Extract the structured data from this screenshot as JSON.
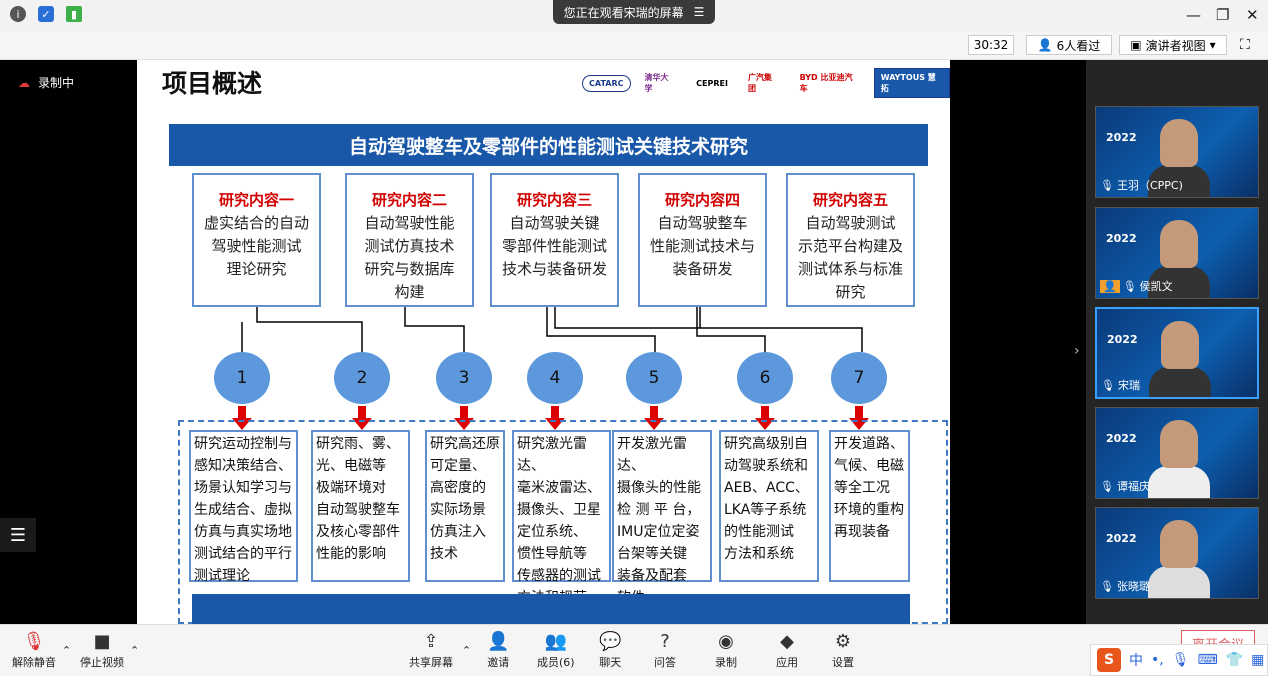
{
  "titlebar": {
    "viewing": "您正在观看宋瑞的屏幕",
    "viewing_icon": "list-icon"
  },
  "toolbar": {
    "timer": "30:32",
    "viewers": "6人看过",
    "speaker_view": "演讲者视图"
  },
  "stage": {
    "recording": "录制中"
  },
  "slide": {
    "title": "项目概述",
    "logos": [
      "CATARC",
      "清华大学",
      "CEPREI",
      "广汽集团",
      "BYD 比亚迪汽车",
      "WAYTOUS 慧拓"
    ],
    "banner": "自动驾驶整车及零部件的性能测试关键技术研究",
    "cards": [
      {
        "head": "研究内容一",
        "lines": [
          "虚实结合的自动",
          "驾驶性能测试",
          "理论研究"
        ]
      },
      {
        "head": "研究内容二",
        "lines": [
          "自动驾驶性能",
          "测试仿真技术",
          "研究与数据库",
          "构建"
        ]
      },
      {
        "head": "研究内容三",
        "lines": [
          "自动驾驶关键",
          "零部件性能测试",
          "技术与装备研发"
        ]
      },
      {
        "head": "研究内容四",
        "lines": [
          "自动驾驶整车",
          "性能测试技术与",
          "装备研发"
        ]
      },
      {
        "head": "研究内容五",
        "lines": [
          "自动驾驶测试",
          "示范平台构建及",
          "测试体系与标准",
          "研究"
        ]
      }
    ],
    "circles": [
      "1",
      "2",
      "3",
      "4",
      "5",
      "6",
      "7"
    ],
    "items": [
      [
        "研究运动控制与",
        "感知决策结合、",
        "场景认知学习与",
        "生成结合、虚拟",
        "仿真与真实场地",
        "测试结合的平行",
        "测试理论"
      ],
      [
        "研究雨、雾、",
        "光、电磁等",
        "极端环境对",
        "自动驾驶整车",
        "及核心零部件",
        "性能的影响"
      ],
      [
        "研究高还原",
        "可定量、",
        "高密度的",
        "实际场景",
        "仿真注入",
        "技术"
      ],
      [
        "研究激光雷达、",
        "毫米波雷达、",
        "摄像头、卫星",
        "定位系统、",
        "惯性导航等",
        "传感器的测试",
        "方法和规范"
      ],
      [
        "开发激光雷达、",
        "摄像头的性能",
        "检 测 平 台，",
        "IMU定位定姿",
        "台架等关键",
        "装备及配套",
        "软件"
      ],
      [
        "研究高级别自",
        "动驾驶系统和",
        "AEB、ACC、",
        "LKA等子系统",
        "的性能测试",
        "方法和系统"
      ],
      [
        "开发道路、",
        "气候、电磁",
        "等全工况",
        "环境的重构",
        "再现装备"
      ]
    ]
  },
  "participants": [
    {
      "name": "王羽（CPPC)",
      "year": "2022"
    },
    {
      "name": "侯凯文",
      "year": "2022"
    },
    {
      "name": "宋瑞",
      "year": "2022"
    },
    {
      "name": "谭福庆",
      "year": "2022"
    },
    {
      "name": "张晓璐",
      "year": "2022"
    }
  ],
  "bottom": {
    "unmute": "解除静音",
    "stop_video": "停止视频",
    "share": "共享屏幕",
    "invite": "邀请",
    "members": "成员(6)",
    "chat": "聊天",
    "qa": "问答",
    "record": "录制",
    "apps": "应用",
    "settings": "设置",
    "leave": "离开会议"
  },
  "ime": {
    "logo": "S",
    "lang": "中",
    "punct": "•,"
  }
}
